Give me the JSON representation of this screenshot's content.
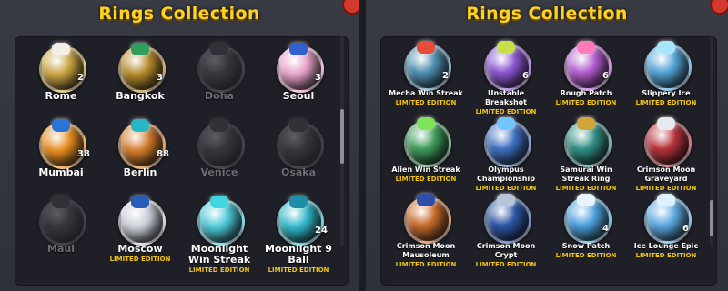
{
  "left": {
    "title": "Rings Collection",
    "items": [
      {
        "name": "Rome",
        "count": "2",
        "locked": false,
        "color": "#c9a441",
        "gem": "#f4efe6",
        "badge": ""
      },
      {
        "name": "Bangkok",
        "count": "3",
        "locked": false,
        "color": "#b58a2a",
        "gem": "#2e9e5a",
        "badge": ""
      },
      {
        "name": "Doha",
        "count": "",
        "locked": true,
        "color": "#6b6f7a",
        "gem": "#5c6270",
        "badge": ""
      },
      {
        "name": "Seoul",
        "count": "3",
        "locked": false,
        "color": "#e6a1c8",
        "gem": "#2f5fd1",
        "badge": ""
      },
      {
        "name": "Mumbai",
        "count": "38",
        "locked": false,
        "color": "#e38b1e",
        "gem": "#2a74d6",
        "badge": ""
      },
      {
        "name": "Berlin",
        "count": "88",
        "locked": false,
        "color": "#d17b2b",
        "gem": "#26b7c4",
        "badge": ""
      },
      {
        "name": "Venice",
        "count": "",
        "locked": true,
        "color": "#6a6e7a",
        "gem": "#5a6070",
        "badge": ""
      },
      {
        "name": "Osaka",
        "count": "",
        "locked": true,
        "color": "#6c6f79",
        "gem": "#5b616e",
        "badge": ""
      },
      {
        "name": "Maui",
        "count": "",
        "locked": true,
        "color": "#686b74",
        "gem": "#575d69",
        "badge": ""
      },
      {
        "name": "Moscow",
        "count": "",
        "locked": false,
        "color": "#c7ccd6",
        "gem": "#2b5bb8",
        "badge": "LIMITED EDITION"
      },
      {
        "name": "Moonlight Win Streak",
        "count": "",
        "locked": false,
        "color": "#4bc7d6",
        "gem": "#3fd6e0",
        "badge": "LIMITED EDITION"
      },
      {
        "name": "Moonlight 9 Ball",
        "count": "24",
        "locked": false,
        "color": "#2fb7c9",
        "gem": "#1d8ea6",
        "badge": "LIMITED EDITION"
      }
    ]
  },
  "right": {
    "title": "Rings Collection",
    "items": [
      {
        "name": "Mecha Win Streak",
        "count": "2",
        "color": "#4e8fb0",
        "gem": "#e84b3c",
        "badge": "LIMITED EDITION"
      },
      {
        "name": "Unstable Breakshot",
        "count": "6",
        "color": "#8b55d1",
        "gem": "#c7e04a",
        "badge": "LIMITED EDITION"
      },
      {
        "name": "Rough Patch",
        "count": "6",
        "color": "#b35ccf",
        "gem": "#ff7ab8",
        "badge": "LIMITED EDITION"
      },
      {
        "name": "Slippery Ice",
        "count": "",
        "color": "#52a3d6",
        "gem": "#a7e6ff",
        "badge": "LIMITED EDITION"
      },
      {
        "name": "Alien Win Streak",
        "count": "",
        "color": "#3e9b59",
        "gem": "#7fe35a",
        "badge": "LIMITED EDITION"
      },
      {
        "name": "Olympus Championship",
        "count": "",
        "color": "#3d6fc2",
        "gem": "#72c6ff",
        "badge": "LIMITED EDITION"
      },
      {
        "name": "Samurai Win Streak Ring",
        "count": "",
        "color": "#2f8f86",
        "gem": "#d2a43a",
        "badge": "LIMITED EDITION"
      },
      {
        "name": "Crimson Moon Graveyard",
        "count": "",
        "color": "#b7313a",
        "gem": "#e8e8f0",
        "badge": "LIMITED EDITION"
      },
      {
        "name": "Crimson Moon Mausoleum",
        "count": "",
        "color": "#c86a2a",
        "gem": "#2d4fa8",
        "badge": "LIMITED EDITION"
      },
      {
        "name": "Crimson Moon Crypt",
        "count": "",
        "color": "#2c55a6",
        "gem": "#b8c4da",
        "badge": "LIMITED EDITION"
      },
      {
        "name": "Snow Patch",
        "count": "4",
        "color": "#4aa0dd",
        "gem": "#e8f4ff",
        "badge": "LIMITED EDITION"
      },
      {
        "name": "Ice Lounge Epic",
        "count": "6",
        "color": "#5aa8e0",
        "gem": "#dff1ff",
        "badge": "LIMITED EDITION"
      }
    ]
  }
}
